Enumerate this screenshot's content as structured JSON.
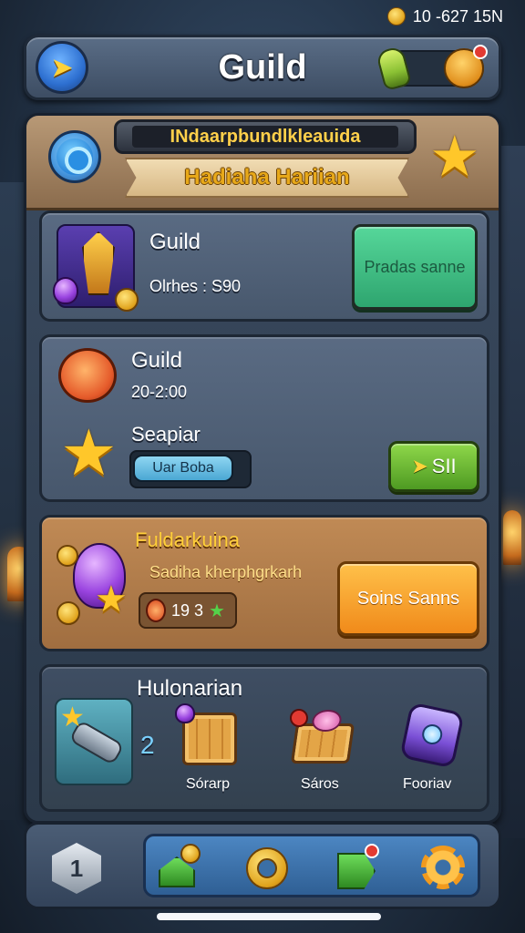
{
  "status_bar": {
    "text": "10 -627 15N"
  },
  "header": {
    "title": "Guild"
  },
  "banner": {
    "top_text": "INdaarpbundlkleauida",
    "ribbon_text": "Hadiaha Hariian"
  },
  "cards": {
    "card1": {
      "title": "Guild",
      "subtitle": "Olrhes : S90",
      "button_label": "Pradas sanne"
    },
    "card2": {
      "title": "Guild",
      "time": "20-2:00",
      "section_label": "Seapiar",
      "field_value": "Uar Boba",
      "button_label": "SII"
    },
    "card3": {
      "title": "Fuldarkuina",
      "subtitle": "Sadiha kherphgrkarh",
      "counter_value": "19 3",
      "button_label": "Soins Sanns"
    },
    "card4": {
      "title": "Hulonarian",
      "count": "2",
      "rewards": [
        {
          "label": "Sórarp",
          "icon": "crate-icon"
        },
        {
          "label": "Sáros",
          "icon": "gift-crate-icon"
        },
        {
          "label": "Fooriav",
          "icon": "amulet-icon"
        }
      ]
    }
  },
  "bottom_nav": {
    "items": [
      {
        "icon": "badge-icon"
      },
      {
        "icon": "home-icon"
      },
      {
        "icon": "coin-ring-icon"
      },
      {
        "icon": "percent-tag-icon"
      },
      {
        "icon": "settings-gear-icon"
      }
    ]
  },
  "colors": {
    "accent_gold": "#ffc72a",
    "button_green": "#2ea56f",
    "button_orange": "#f08a1a",
    "panel_blue": "#47576c"
  }
}
